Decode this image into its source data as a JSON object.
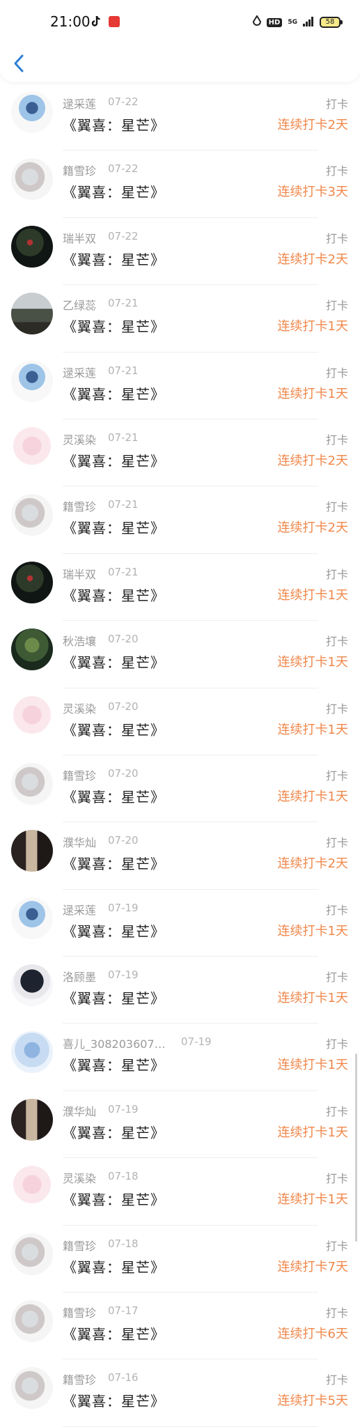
{
  "status_bar": {
    "time": "21:00",
    "battery": "58",
    "hd": "HD",
    "network": "5G"
  },
  "header": {
    "back_icon": "chevron-left-icon"
  },
  "items": [
    {
      "name": "逯采莲",
      "date": "07-22",
      "title": "《翼喜：星芒》",
      "type": "打卡",
      "streak": "连续打卡2天",
      "avatar": "av-boy"
    },
    {
      "name": "籍雪珍",
      "date": "07-22",
      "title": "《翼喜：星芒》",
      "type": "打卡",
      "streak": "连续打卡3天",
      "avatar": "av-girl"
    },
    {
      "name": "瑞半双",
      "date": "07-22",
      "title": "《翼喜：星芒》",
      "type": "打卡",
      "streak": "连续打卡2天",
      "avatar": "av-night"
    },
    {
      "name": "乙绿蕊",
      "date": "07-21",
      "title": "《翼喜：星芒》",
      "type": "打卡",
      "streak": "连续打卡1天",
      "avatar": "av-landscape"
    },
    {
      "name": "逯采莲",
      "date": "07-21",
      "title": "《翼喜：星芒》",
      "type": "打卡",
      "streak": "连续打卡1天",
      "avatar": "av-boy"
    },
    {
      "name": "灵溪染",
      "date": "07-21",
      "title": "《翼喜：星芒》",
      "type": "打卡",
      "streak": "连续打卡2天",
      "avatar": "av-pink"
    },
    {
      "name": "籍雪珍",
      "date": "07-21",
      "title": "《翼喜：星芒》",
      "type": "打卡",
      "streak": "连续打卡2天",
      "avatar": "av-girl"
    },
    {
      "name": "瑞半双",
      "date": "07-21",
      "title": "《翼喜：星芒》",
      "type": "打卡",
      "streak": "连续打卡1天",
      "avatar": "av-night"
    },
    {
      "name": "秋浩壤",
      "date": "07-20",
      "title": "《翼喜：星芒》",
      "type": "打卡",
      "streak": "连续打卡1天",
      "avatar": "av-forest"
    },
    {
      "name": "灵溪染",
      "date": "07-20",
      "title": "《翼喜：星芒》",
      "type": "打卡",
      "streak": "连续打卡1天",
      "avatar": "av-pink"
    },
    {
      "name": "籍雪珍",
      "date": "07-20",
      "title": "《翼喜：星芒》",
      "type": "打卡",
      "streak": "连续打卡1天",
      "avatar": "av-girl"
    },
    {
      "name": "濮华灿",
      "date": "07-20",
      "title": "《翼喜：星芒》",
      "type": "打卡",
      "streak": "连续打卡2天",
      "avatar": "av-dark"
    },
    {
      "name": "逯采莲",
      "date": "07-19",
      "title": "《翼喜：星芒》",
      "type": "打卡",
      "streak": "连续打卡1天",
      "avatar": "av-boy"
    },
    {
      "name": "洛顾墨",
      "date": "07-19",
      "title": "《翼喜：星芒》",
      "type": "打卡",
      "streak": "连续打卡1天",
      "avatar": "av-anime"
    },
    {
      "name": "喜儿_3082036070...",
      "date": "07-19",
      "title": "《翼喜：星芒》",
      "type": "打卡",
      "streak": "连续打卡1天",
      "avatar": "av-blue"
    },
    {
      "name": "濮华灿",
      "date": "07-19",
      "title": "《翼喜：星芒》",
      "type": "打卡",
      "streak": "连续打卡1天",
      "avatar": "av-dark"
    },
    {
      "name": "灵溪染",
      "date": "07-18",
      "title": "《翼喜：星芒》",
      "type": "打卡",
      "streak": "连续打卡1天",
      "avatar": "av-pink"
    },
    {
      "name": "籍雪珍",
      "date": "07-18",
      "title": "《翼喜：星芒》",
      "type": "打卡",
      "streak": "连续打卡7天",
      "avatar": "av-girl"
    },
    {
      "name": "籍雪珍",
      "date": "07-17",
      "title": "《翼喜：星芒》",
      "type": "打卡",
      "streak": "连续打卡6天",
      "avatar": "av-girl"
    },
    {
      "name": "籍雪珍",
      "date": "07-16",
      "title": "《翼喜：星芒》",
      "type": "打卡",
      "streak": "连续打卡5天",
      "avatar": "av-girl"
    }
  ]
}
